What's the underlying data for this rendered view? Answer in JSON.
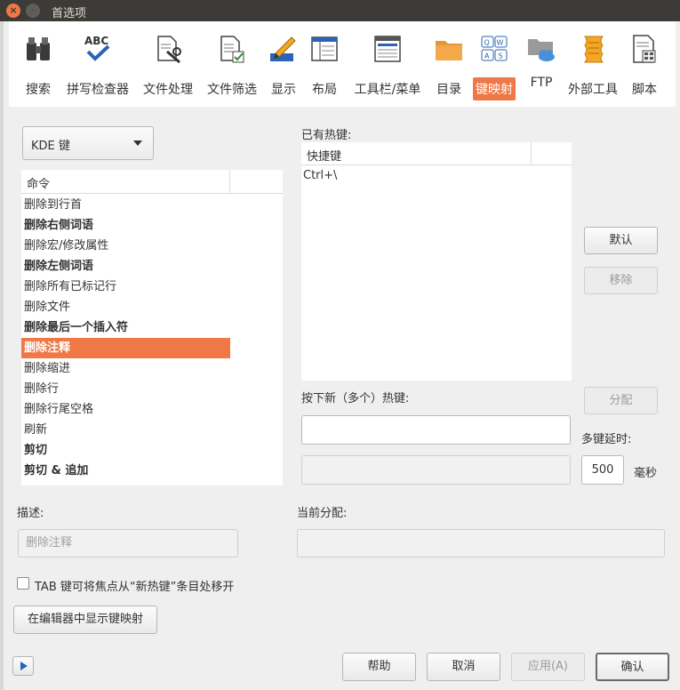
{
  "window": {
    "title": "首选项"
  },
  "toolbar": {
    "items": [
      {
        "label": "搜索",
        "icon": "binoculars-icon"
      },
      {
        "label": "拼写检查器",
        "icon": "spellcheck-icon"
      },
      {
        "label": "文件处理",
        "icon": "file-tools-icon"
      },
      {
        "label": "文件筛选",
        "icon": "file-filter-icon"
      },
      {
        "label": "显示",
        "icon": "display-pen-icon"
      },
      {
        "label": "布局",
        "icon": "layout-icon"
      },
      {
        "label": "工具栏/菜单",
        "icon": "toolbar-menu-icon"
      },
      {
        "label": "目录",
        "icon": "folder-icon"
      },
      {
        "label": "键映射",
        "icon": "keymap-icon"
      },
      {
        "label": "FTP",
        "icon": "ftp-folder-icon"
      },
      {
        "label": "外部工具",
        "icon": "scroll-icon"
      },
      {
        "label": "脚本",
        "icon": "script-icon"
      }
    ],
    "active": "键映射"
  },
  "keymap": {
    "scheme": "KDE 键",
    "commands_header": "命令",
    "commands": [
      {
        "label": "删除到行首",
        "bold": false
      },
      {
        "label": "删除右侧词语",
        "bold": true
      },
      {
        "label": "删除宏/修改属性",
        "bold": false
      },
      {
        "label": "删除左侧词语",
        "bold": true
      },
      {
        "label": "删除所有已标记行",
        "bold": false
      },
      {
        "label": "删除文件",
        "bold": false
      },
      {
        "label": "删除最后一个插入符",
        "bold": true
      },
      {
        "label": "删除注释",
        "bold": true,
        "selected": true
      },
      {
        "label": "删除缩进",
        "bold": false
      },
      {
        "label": "删除行",
        "bold": false
      },
      {
        "label": "删除行尾空格",
        "bold": false
      },
      {
        "label": "刷新",
        "bold": false
      },
      {
        "label": "剪切",
        "bold": true
      },
      {
        "label": "剪切 & 追加",
        "bold": true
      }
    ],
    "existing_label": "已有热键:",
    "shortcut_header": "快捷键",
    "existing_shortcut": "Ctrl+\\",
    "default_button": "默认",
    "remove_button": "移除",
    "new_hotkey_label": "按下新（多个）热键:",
    "assign_button": "分配",
    "multikey_delay_label": "多键延时:",
    "multikey_delay_value": "500",
    "multikey_delay_unit": "毫秒",
    "description_label": "描述:",
    "description_value": "删除注释",
    "current_assignment_label": "当前分配:",
    "tab_checkbox_label": "TAB 键可将焦点从“新热键”条目处移开",
    "show_in_editor_button": "在编辑器中显示键映射"
  },
  "footer": {
    "help": "帮助",
    "cancel": "取消",
    "apply": "应用(A)",
    "ok": "确认"
  },
  "colors": {
    "accent": "#f07746",
    "titlebar": "#3c3b37"
  }
}
